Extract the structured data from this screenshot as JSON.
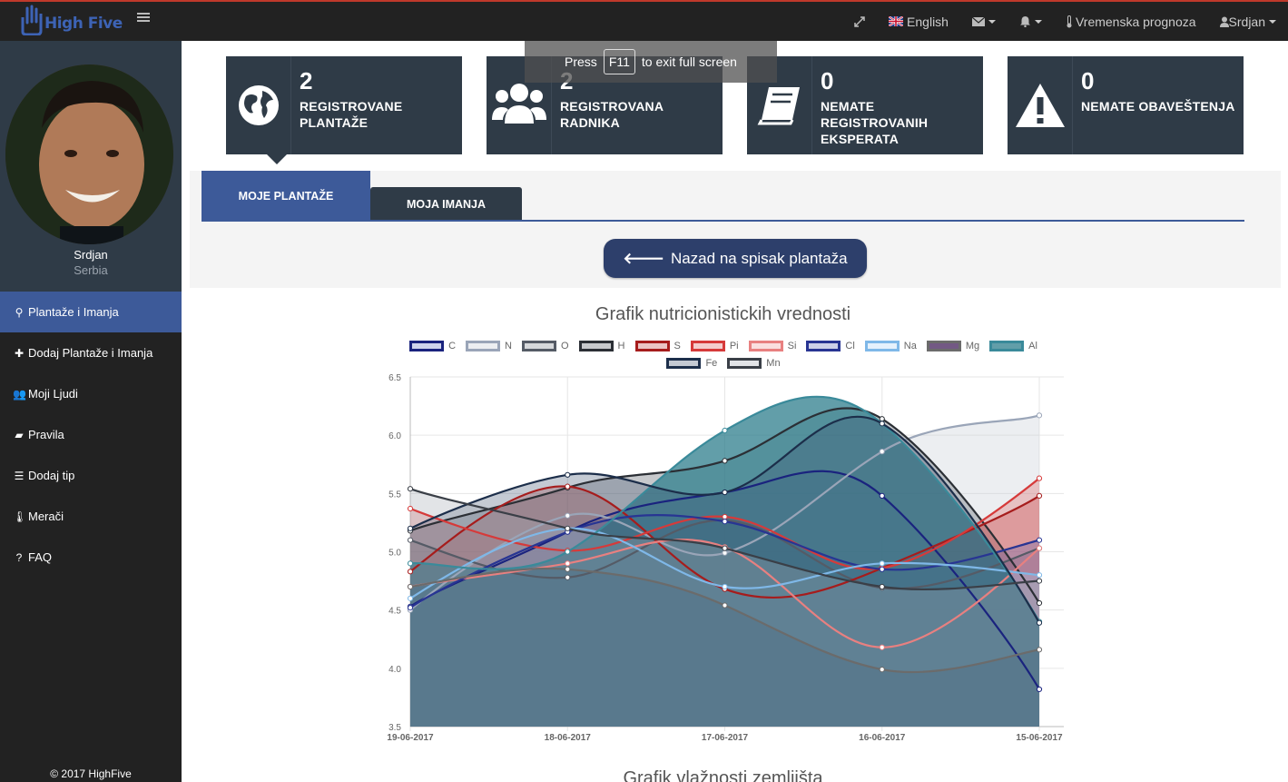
{
  "app": {
    "logo_text": "High Five",
    "colors": {
      "topbar": "#222222",
      "sidebar": "#222222",
      "profile_bg": "#2f3b47",
      "accent": "#3d5a99",
      "card": "#2f3b47"
    }
  },
  "topnav": {
    "language": "English",
    "weather": "Vremenska prognoza",
    "user": "Srdjan",
    "icons": [
      "expand-icon",
      "uk-flag-icon",
      "envelope-icon",
      "bell-icon",
      "thermometer-icon",
      "user-icon"
    ]
  },
  "profile": {
    "name": "Srdjan",
    "country": "Serbia"
  },
  "sidebar": {
    "items": [
      {
        "label": "Plantaže i Imanja",
        "icon": "map-marker-icon",
        "glyph": "⚲",
        "active": true
      },
      {
        "label": "Dodaj Plantaže i Imanja",
        "icon": "plus-icon",
        "glyph": "✚",
        "active": false
      },
      {
        "label": "Moji Ljudi",
        "icon": "users-icon",
        "glyph": "👥",
        "active": false
      },
      {
        "label": "Pravila",
        "icon": "book-icon",
        "glyph": "▰",
        "active": false
      },
      {
        "label": "Dodaj tip",
        "icon": "database-icon",
        "glyph": "☰",
        "active": false
      },
      {
        "label": "Merači",
        "icon": "thermometer-icon",
        "glyph": "🌡",
        "active": false
      },
      {
        "label": "FAQ",
        "icon": "question-icon",
        "glyph": "?",
        "active": false
      }
    ],
    "copyright": "© 2017 HighFive"
  },
  "cards": [
    {
      "number": "2",
      "label": "Registrovane plantaže",
      "icon": "globe-icon"
    },
    {
      "number": "2",
      "label": "Registrovana radnika",
      "icon": "users-icon"
    },
    {
      "number": "0",
      "label": "Nemate registrovanih eksperata",
      "icon": "book-icon"
    },
    {
      "number": "0",
      "label": "Nemate obaveštenja",
      "icon": "warning-icon"
    }
  ],
  "fullscreen_hint": {
    "before": "Press",
    "key": "F11",
    "after": "to exit full screen"
  },
  "tabs": [
    {
      "label": "Moje plantaže",
      "active": true
    },
    {
      "label": "Moja imanja",
      "active": false
    }
  ],
  "back_button": {
    "label": "Nazad na spisak plantaža",
    "icon": "arrow-left-icon"
  },
  "chart_data": {
    "type": "area",
    "title": "Grafik nutricionistickih vrednosti",
    "categories": [
      "19-06-2017",
      "18-06-2017",
      "17-06-2017",
      "16-06-2017",
      "15-06-2017"
    ],
    "ylim": [
      3.5,
      6.5
    ],
    "yticks": [
      "6.5",
      "6.0",
      "5.5",
      "5.0",
      "4.5",
      "4.0",
      "3.5"
    ],
    "grid": true,
    "legend_position": "top",
    "series": [
      {
        "name": "C",
        "values": [
          4.53,
          5.17,
          5.51,
          5.48,
          3.82
        ],
        "color": "#1a237e",
        "fill": "rgba(63,81,181,0.25)"
      },
      {
        "name": "N",
        "values": [
          4.5,
          5.31,
          4.99,
          5.86,
          6.17
        ],
        "color": "#9aa5b8",
        "fill": "rgba(200,205,215,0.35)"
      },
      {
        "name": "O",
        "values": [
          5.1,
          4.78,
          5.27,
          4.69,
          5.03
        ],
        "color": "#555b66",
        "fill": "rgba(120,125,135,0.3)"
      },
      {
        "name": "H",
        "values": [
          5.18,
          5.55,
          5.78,
          6.14,
          4.56
        ],
        "color": "#2b2f35",
        "fill": "rgba(95,100,108,0.35)"
      },
      {
        "name": "S",
        "values": [
          4.83,
          5.56,
          4.68,
          4.86,
          5.48
        ],
        "color": "#a61c1c",
        "fill": "rgba(190,60,60,0.3)"
      },
      {
        "name": "Pi",
        "values": [
          5.37,
          5.01,
          5.3,
          4.86,
          5.63
        ],
        "color": "#d63a3a",
        "fill": "rgba(220,90,90,0.3)"
      },
      {
        "name": "Si",
        "values": [
          4.7,
          4.9,
          5.04,
          4.18,
          5.03
        ],
        "color": "#e88080",
        "fill": "rgba(240,150,150,0.3)"
      },
      {
        "name": "Cl",
        "values": [
          4.52,
          5.17,
          5.26,
          4.85,
          5.1
        ],
        "color": "#283593",
        "fill": "rgba(90,100,180,0.3)"
      },
      {
        "name": "Na",
        "values": [
          4.6,
          5.2,
          4.7,
          4.9,
          4.8
        ],
        "color": "#7fb8e8",
        "fill": "rgba(170,210,245,0.3)"
      },
      {
        "name": "Mg",
        "values": [
          4.7,
          4.85,
          4.54,
          3.99,
          4.16
        ],
        "color": "#6b6b6b",
        "fill": "rgba(90,60,110,0.85)"
      },
      {
        "name": "Al",
        "values": [
          4.9,
          5.0,
          6.04,
          6.1,
          4.4
        ],
        "color": "#3a8a9a",
        "fill": "rgba(45,125,140,0.75)"
      },
      {
        "name": "Fe",
        "values": [
          5.2,
          5.66,
          5.51,
          6.1,
          4.39
        ],
        "color": "#1c2e4a",
        "fill": "rgba(60,80,110,0.3)"
      },
      {
        "name": "Mn",
        "values": [
          5.54,
          5.2,
          5.03,
          4.7,
          4.75
        ],
        "color": "#3a3f47",
        "fill": "rgba(160,165,175,0.3)"
      }
    ]
  },
  "chart2": {
    "title": "Grafik vlažnosti zemljišta"
  }
}
